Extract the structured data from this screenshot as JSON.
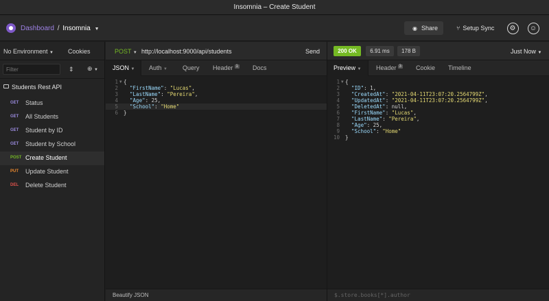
{
  "window": {
    "title": "Insomnia – Create Student"
  },
  "header": {
    "dashboard": "Dashboard",
    "separator": "/",
    "project": "Insomnia",
    "share": "Share",
    "setup_sync": "Setup Sync"
  },
  "sidebar": {
    "environment": "No Environment",
    "cookies": "Cookies",
    "filter_placeholder": "Filter",
    "folder": "Students Rest API",
    "items": [
      {
        "method": "GET",
        "name": "Status"
      },
      {
        "method": "GET",
        "name": "All Students"
      },
      {
        "method": "GET",
        "name": "Student by ID"
      },
      {
        "method": "GET",
        "name": "Student by School"
      },
      {
        "method": "POST",
        "name": "Create Student"
      },
      {
        "method": "PUT",
        "name": "Update Student"
      },
      {
        "method": "DEL",
        "name": "Delete Student"
      }
    ]
  },
  "request": {
    "method": "POST",
    "url": "http://localhost:9000/api/students",
    "send": "Send",
    "tabs": {
      "body": "JSON",
      "auth": "Auth",
      "query": "Query",
      "header": "Header",
      "header_count": "1",
      "docs": "Docs"
    },
    "body_lines": [
      {
        "n": "1",
        "fold": true
      },
      {
        "n": "2",
        "key": "\"FirstName\"",
        "val": "\"Lucas\"",
        "comma": ","
      },
      {
        "n": "3",
        "key": "\"LastName\"",
        "val": "\"Pereira\"",
        "comma": ","
      },
      {
        "n": "4",
        "key": "\"Age\"",
        "num": "25",
        "comma": ","
      },
      {
        "n": "5",
        "key": "\"School\"",
        "val": "\"Home\"",
        "comma": ""
      },
      {
        "n": "6"
      }
    ],
    "footer": "Beautify JSON"
  },
  "response": {
    "status": "200 OK",
    "time": "6.91 ms",
    "size": "178 B",
    "when": "Just Now",
    "tabs": {
      "preview": "Preview",
      "header": "Header",
      "header_count": "3",
      "cookie": "Cookie",
      "timeline": "Timeline"
    },
    "body_lines": [
      {
        "n": "1",
        "fold": true
      },
      {
        "n": "2",
        "key": "\"ID\"",
        "num": "1",
        "comma": ","
      },
      {
        "n": "3",
        "key": "\"CreatedAt\"",
        "val": "\"2021-04-11T23:07:20.2564799Z\"",
        "comma": ","
      },
      {
        "n": "4",
        "key": "\"UpdatedAt\"",
        "val": "\"2021-04-11T23:07:20.2564799Z\"",
        "comma": ","
      },
      {
        "n": "5",
        "key": "\"DeletedAt\"",
        "nul": "null",
        "comma": ","
      },
      {
        "n": "6",
        "key": "\"FirstName\"",
        "val": "\"Lucas\"",
        "comma": ","
      },
      {
        "n": "7",
        "key": "\"LastName\"",
        "val": "\"Pereira\"",
        "comma": ","
      },
      {
        "n": "8",
        "key": "\"Age\"",
        "num": "25",
        "comma": ","
      },
      {
        "n": "9",
        "key": "\"School\"",
        "val": "\"Home\"",
        "comma": ""
      },
      {
        "n": "10"
      }
    ],
    "footer": "$.store.books[*].author"
  },
  "colors": {
    "accent": "#7e59c7",
    "get": "#9a8ade",
    "post": "#75ba24",
    "put": "#ed8a2e",
    "delete": "#e0524c",
    "ok": "#75ba24"
  }
}
